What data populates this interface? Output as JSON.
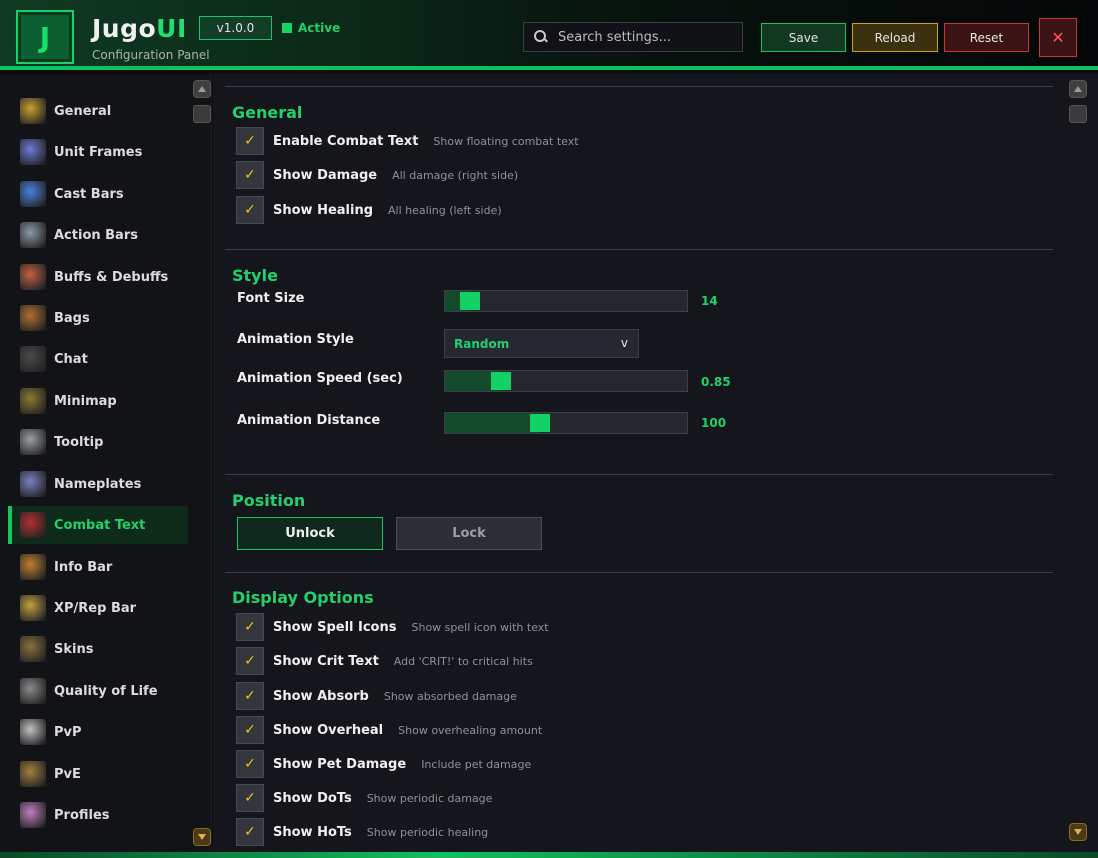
{
  "header": {
    "logo_letter": "J",
    "title_main": "Jugo",
    "title_accent": "UI",
    "subtitle": "Configuration Panel",
    "version": "v1.0.0",
    "status": "Active",
    "search_placeholder": "Search settings...",
    "save_label": "Save",
    "reload_label": "Reload",
    "reset_label": "Reset",
    "close_label": "✕"
  },
  "sidebar": {
    "items": [
      {
        "label": "General",
        "icon": "gear-icon"
      },
      {
        "label": "Unit Frames",
        "icon": "portrait-icon"
      },
      {
        "label": "Cast Bars",
        "icon": "spell-icon"
      },
      {
        "label": "Action Bars",
        "icon": "sword-icon"
      },
      {
        "label": "Buffs & Debuffs",
        "icon": "aura-icon"
      },
      {
        "label": "Bags",
        "icon": "bag-icon"
      },
      {
        "label": "Chat",
        "icon": "chat-icon"
      },
      {
        "label": "Minimap",
        "icon": "map-icon"
      },
      {
        "label": "Tooltip",
        "icon": "scroll-icon"
      },
      {
        "label": "Nameplates",
        "icon": "arrow-icon"
      },
      {
        "label": "Combat Text",
        "icon": "combat-text-icon"
      },
      {
        "label": "Info Bar",
        "icon": "info-icon"
      },
      {
        "label": "XP/Rep Bar",
        "icon": "experience-icon"
      },
      {
        "label": "Skins",
        "icon": "paint-icon"
      },
      {
        "label": "Quality of Life",
        "icon": "helmet-icon"
      },
      {
        "label": "PvP",
        "icon": "crossed-swords-icon"
      },
      {
        "label": "PvE",
        "icon": "dungeon-icon"
      },
      {
        "label": "Profiles",
        "icon": "profile-icon"
      }
    ],
    "active_index": 10
  },
  "sections": {
    "general": {
      "title": "General",
      "checkboxes": [
        {
          "label": "Enable Combat Text",
          "desc": "Show floating combat text",
          "checked": true
        },
        {
          "label": "Show Damage",
          "desc": "All damage (right side)",
          "checked": true
        },
        {
          "label": "Show Healing",
          "desc": "All healing (left side)",
          "checked": true
        }
      ]
    },
    "style": {
      "title": "Style",
      "font_size_label": "Font Size",
      "font_size_value": "14",
      "font_size_fraction": 0.06,
      "animation_style_label": "Animation Style",
      "animation_style_value": "Random",
      "animation_style_chevron": "v",
      "animation_speed_label": "Animation Speed (sec)",
      "animation_speed_value": "0.85",
      "animation_speed_fraction": 0.19,
      "animation_distance_label": "Animation Distance",
      "animation_distance_value": "100",
      "animation_distance_fraction": 0.35
    },
    "position": {
      "title": "Position",
      "unlock_label": "Unlock",
      "lock_label": "Lock"
    },
    "display": {
      "title": "Display Options",
      "checkboxes": [
        {
          "label": "Show Spell Icons",
          "desc": "Show spell icon with text",
          "checked": true
        },
        {
          "label": "Show Crit Text",
          "desc": "Add 'CRIT!' to critical hits",
          "checked": true
        },
        {
          "label": "Show Absorb",
          "desc": "Show absorbed damage",
          "checked": true
        },
        {
          "label": "Show Overheal",
          "desc": "Show overhealing amount",
          "checked": true
        },
        {
          "label": "Show Pet Damage",
          "desc": "Include pet damage",
          "checked": true
        },
        {
          "label": "Show DoTs",
          "desc": "Show periodic damage",
          "checked": true
        },
        {
          "label": "Show HoTs",
          "desc": "Show periodic healing",
          "checked": true
        }
      ]
    }
  },
  "colors": {
    "accent": "#22d06c",
    "save": "#1ec45f",
    "reload": "#c8a21a",
    "reset": "#c53838",
    "check": "#f2c21a"
  }
}
